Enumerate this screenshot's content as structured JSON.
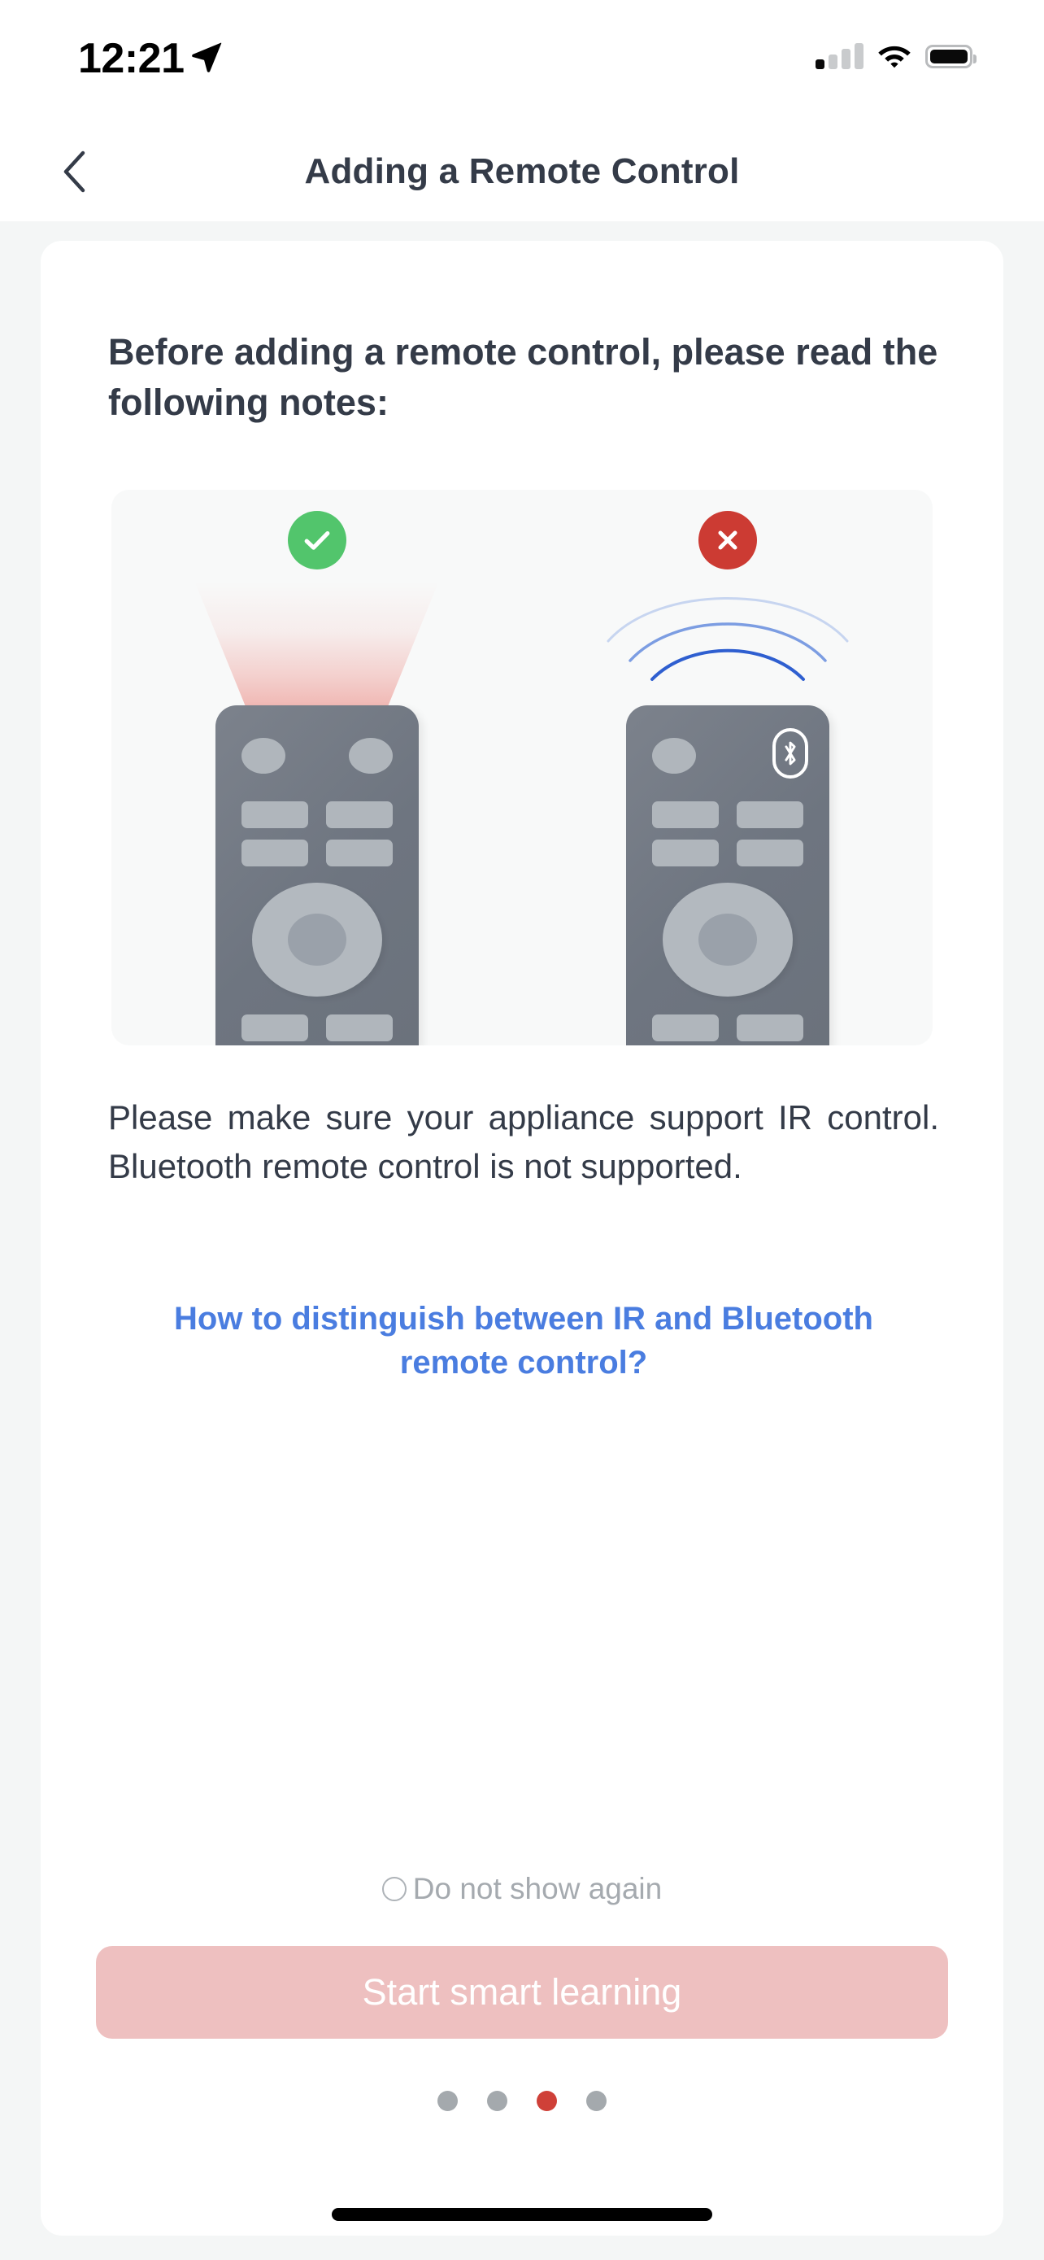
{
  "status_bar": {
    "time": "12:21",
    "location_icon": "location-arrow-icon",
    "cellular_icon": "cellular-signal-icon",
    "cellular_bars_filled": 1,
    "cellular_bars_total": 4,
    "wifi_icon": "wifi-icon",
    "battery_icon": "battery-full-icon"
  },
  "nav": {
    "back_icon": "chevron-left-icon",
    "title": "Adding a Remote Control"
  },
  "content": {
    "heading": "Before adding a remote control, please read the following notes:",
    "body": "Please make sure your appliance support IR control. Bluetooth remote control is not supported.",
    "link": "How to distinguish between IR and Bluetooth remote control?"
  },
  "illustration": {
    "left": {
      "badge_icon": "check-circle-icon",
      "badge_color": "#52c56c",
      "signal_type": "ir-beam",
      "signal_color": "#e4564a",
      "remote_icon": "ir-remote-icon"
    },
    "right": {
      "badge_icon": "x-circle-icon",
      "badge_color": "#cc3b33",
      "signal_type": "bluetooth-waves",
      "signal_color": "#3d6fd6",
      "remote_icon": "bluetooth-remote-icon",
      "remote_badge_icon": "bluetooth-icon"
    }
  },
  "footer": {
    "do_not_show_again": "Do not show again",
    "do_not_show_again_checked": false,
    "cta_label": "Start smart learning",
    "cta_color": "#eec0c0"
  },
  "pager": {
    "total": 4,
    "active_index": 2,
    "active_color": "#cf4038",
    "inactive_color": "#a4a9ad"
  }
}
